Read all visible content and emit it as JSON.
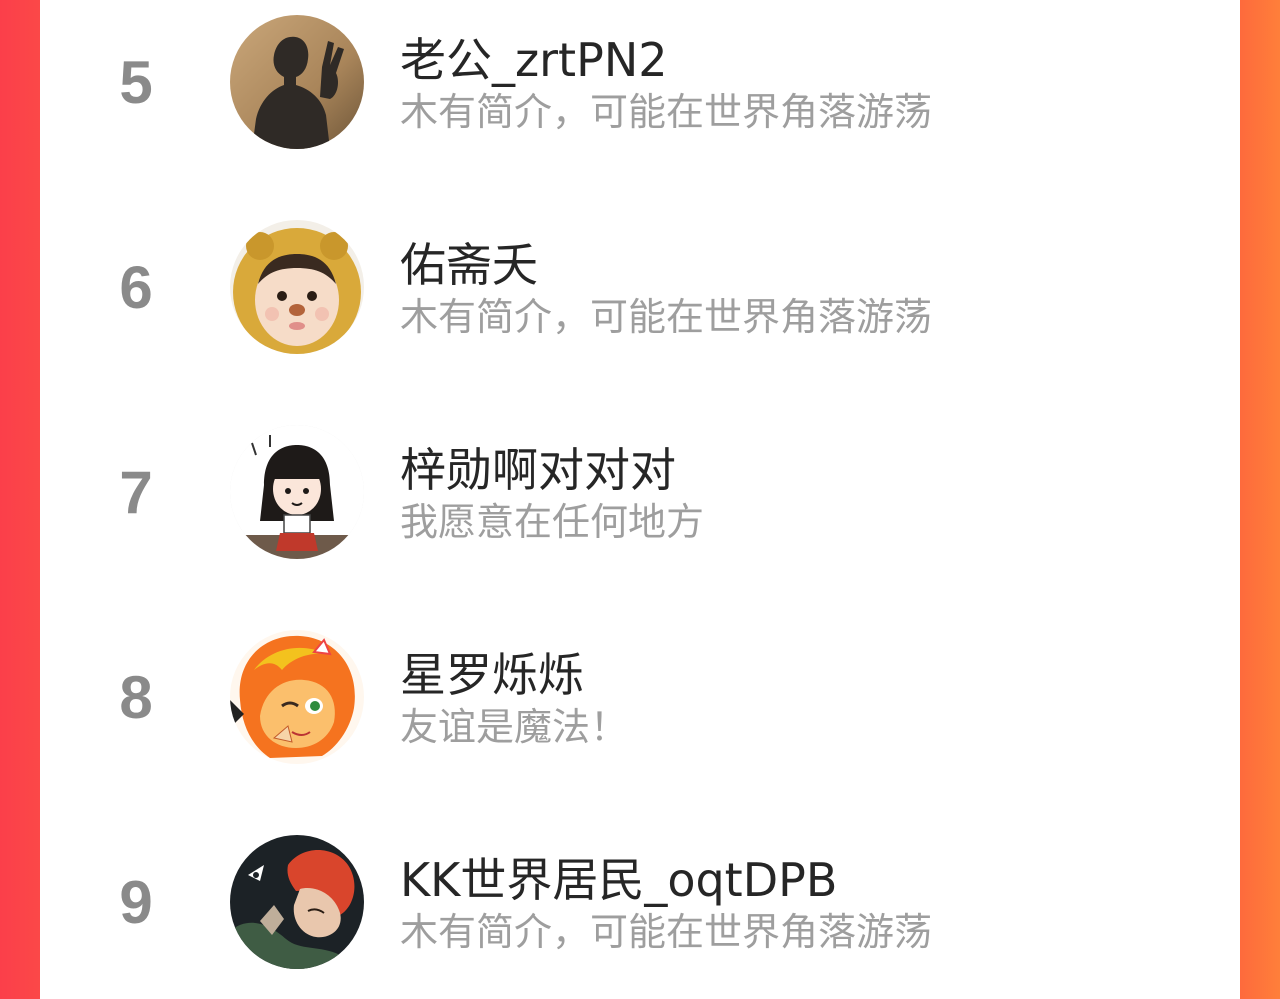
{
  "theme": {
    "side_accent_left": "#fb4848",
    "side_accent_right": "#ff7f3a",
    "rank_color": "#8a8a8a",
    "name_color": "#262626",
    "bio_color": "#9e9e9e"
  },
  "ranking": {
    "items": [
      {
        "rank": "5",
        "name": "老公_zrtPN2",
        "bio": "木有简介，可能在世界角落游荡",
        "avatar": "silhouette-peace-sign-avatar"
      },
      {
        "rank": "6",
        "name": "佑斋夭",
        "bio": "木有简介，可能在世界角落游荡",
        "avatar": "child-yellow-hood-avatar"
      },
      {
        "rank": "7",
        "name": "梓勋啊对对对",
        "bio": "我愿意在任何地方",
        "avatar": "cartoon-girl-sticker-avatar"
      },
      {
        "rank": "8",
        "name": "星罗烁烁",
        "bio": "友谊是魔法！",
        "avatar": "anime-pony-girl-avatar"
      },
      {
        "rank": "9",
        "name": "KK世界居民_oqtDPB",
        "bio": "木有简介，可能在世界角落游荡",
        "avatar": "red-hair-anime-avatar"
      }
    ]
  }
}
